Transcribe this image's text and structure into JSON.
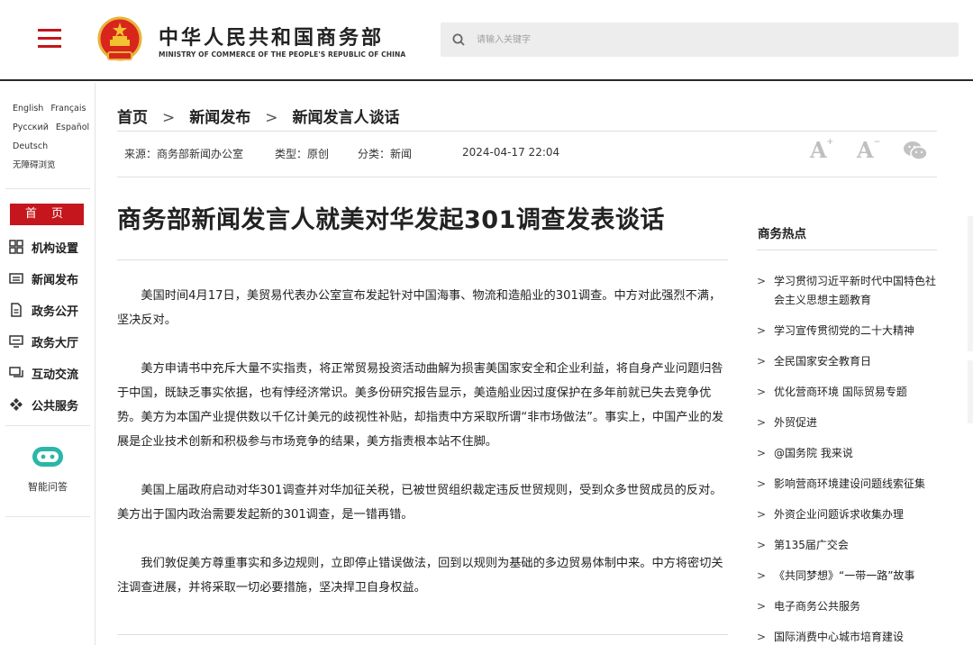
{
  "header": {
    "brand_cn": "中华人民共和国商务部",
    "brand_en": "MINISTRY OF COMMERCE OF THE PEOPLE'S REPUBLIC OF CHINA",
    "search_placeholder": "请输入关键字"
  },
  "sidebar": {
    "languages": [
      "English",
      "Français",
      "Русский",
      "Español",
      "Deutsch",
      "无障碍浏览"
    ],
    "home_label": "首 页",
    "nav": [
      {
        "label": "机构设置",
        "icon": "grid-icon"
      },
      {
        "label": "新闻发布",
        "icon": "newspaper-icon"
      },
      {
        "label": "政务公开",
        "icon": "document-icon"
      },
      {
        "label": "政务大厅",
        "icon": "monitor-icon"
      },
      {
        "label": "互动交流",
        "icon": "chat-icon"
      },
      {
        "label": "公共服务",
        "icon": "service-icon"
      }
    ],
    "ai_label": "智能问答"
  },
  "breadcrumb": [
    "首页",
    "新闻发布",
    "新闻发言人谈话"
  ],
  "meta": {
    "source": "来源：商务部新闻办公室",
    "type": "类型：原创",
    "category": "分类：新闻",
    "date": "2024-04-17 22:04"
  },
  "toolbar": {
    "font_large": "A",
    "font_small": "A",
    "share_icon": "wechat-icon"
  },
  "article": {
    "title": "商务部新闻发言人就美对华发起301调查发表谈话",
    "paragraphs": [
      "美国时间4月17日，美贸易代表办公室宣布发起针对中国海事、物流和造船业的301调查。中方对此强烈不满，坚决反对。",
      "美方申请书中充斥大量不实指责，将正常贸易投资活动曲解为损害美国家安全和企业利益，将自身产业问题归咎于中国，既缺乏事实依据，也有悖经济常识。美多份研究报告显示，美造船业因过度保护在多年前就已失去竞争优势。美方为本国产业提供数以千亿计美元的歧视性补贴，却指责中方采取所谓“非市场做法”。事实上，中国产业的发展是企业技术创新和积极参与市场竞争的结果，美方指责根本站不住脚。",
      "美国上届政府启动对华301调查并对华加征关税，已被世贸组织裁定违反世贸规则，受到众多世贸成员的反对。美方出于国内政治需要发起新的301调查，是一错再错。",
      "我们敦促美方尊重事实和多边规则，立即停止错误做法，回到以规则为基础的多边贸易体制中来。中方将密切关注调查进展，并将采取一切必要措施，坚决捍卫自身权益。"
    ]
  },
  "hot": {
    "title": "商务热点",
    "items": [
      "学习贯彻习近平新时代中国特色社会主义思想主题教育",
      "学习宣传贯彻党的二十大精神",
      "全民国家安全教育日",
      "优化营商环境 国际贸易专题",
      "外贸促进",
      "@国务院 我来说",
      "影响营商环境建设问题线索征集",
      "外资企业问题诉求收集办理",
      "第135届广交会",
      "《共同梦想》“一带一路”故事",
      "电子商务公共服务",
      "国际消费中心城市培育建设"
    ]
  },
  "colors": {
    "accent": "#c4161c",
    "text": "#222222",
    "muted": "#bfbfbf"
  }
}
